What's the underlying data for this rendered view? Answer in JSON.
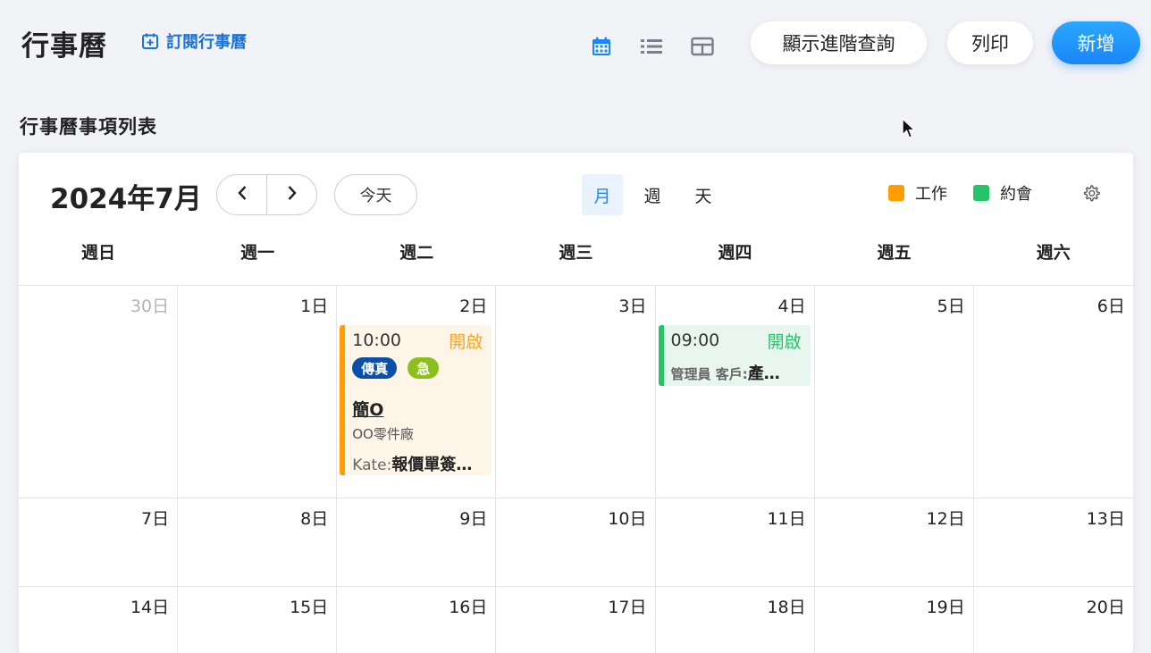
{
  "header": {
    "title": "行事曆",
    "subscribe_label": "訂閱行事曆",
    "view_icons": [
      "calendar-icon",
      "list-icon",
      "table-icon"
    ],
    "buttons": {
      "advanced_query": "顯示進階查詢",
      "print": "列印",
      "add": "新增"
    }
  },
  "section_title": "行事曆事項列表",
  "calendar": {
    "title": "2024年7月",
    "today_label": "今天",
    "modes": [
      "月",
      "週",
      "天"
    ],
    "active_mode": "月",
    "legend": [
      {
        "label": "工作",
        "color": "#ff9d00"
      },
      {
        "label": "約會",
        "color": "#26c46a"
      }
    ],
    "weekdays": [
      "週日",
      "週一",
      "週二",
      "週三",
      "週四",
      "週五",
      "週六"
    ],
    "weeks": [
      [
        "30日",
        "1日",
        "2日",
        "3日",
        "4日",
        "5日",
        "6日"
      ],
      [
        "7日",
        "8日",
        "9日",
        "10日",
        "11日",
        "12日",
        "13日"
      ],
      [
        "14日",
        "15日",
        "16日",
        "17日",
        "18日",
        "19日",
        "20日"
      ]
    ],
    "events": {
      "work": {
        "time": "10:00",
        "status": "開啟",
        "tags": [
          {
            "label": "傳真",
            "color": "#0b4fa8"
          },
          {
            "label": "急",
            "color": "#8cbf1e"
          }
        ],
        "subject": "簡O",
        "company": "OO零件廠",
        "owner": "Kate:",
        "detail": "報價單簽…"
      },
      "meeting": {
        "time": "09:00",
        "status": "開啟",
        "owner": "管理員 客戶:",
        "detail": "產…"
      }
    }
  }
}
